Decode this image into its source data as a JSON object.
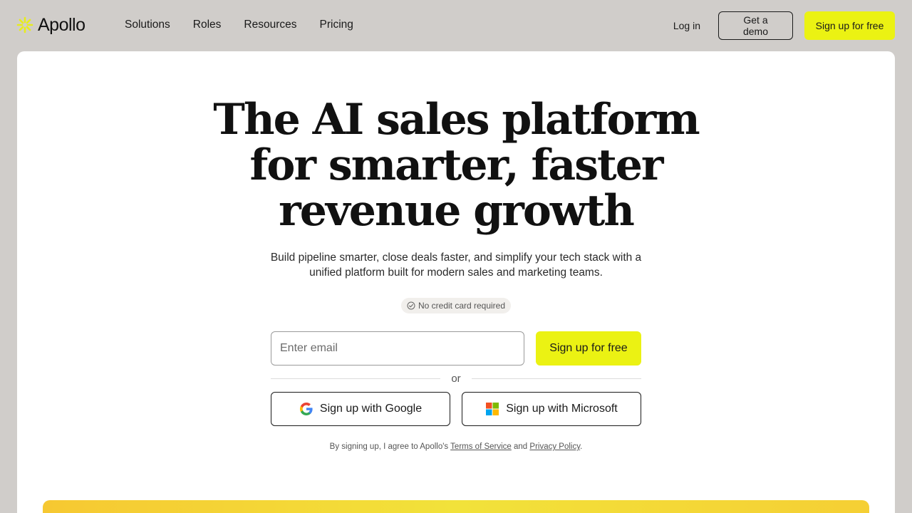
{
  "brand": {
    "name": "Apollo",
    "accent": "#ebf213"
  },
  "nav": {
    "links": [
      "Solutions",
      "Roles",
      "Resources",
      "Pricing"
    ],
    "login": "Log in",
    "demo": "Get a demo",
    "signup": "Sign up for free"
  },
  "hero": {
    "headline": [
      "The AI sales platform",
      "for smarter, faster",
      "revenue growth"
    ],
    "subhead": "Build pipeline smarter, close deals faster, and simplify your tech stack with a unified platform built for modern sales and marketing teams.",
    "badge": "No credit card required",
    "email_placeholder": "Enter email",
    "signup_button": "Sign up for free",
    "or_text": "or",
    "google_button": "Sign up with Google",
    "microsoft_button": "Sign up with Microsoft",
    "legal_prefix": "By signing up, I agree to Apollo's",
    "terms_link": "Terms of Service",
    "legal_and": "and",
    "privacy_link": "Privacy Policy",
    "legal_suffix": "."
  },
  "icons": {
    "logo": "apollo-sunburst-icon",
    "badge": "check-circle-icon",
    "google": "google-icon",
    "microsoft": "microsoft-icon"
  }
}
